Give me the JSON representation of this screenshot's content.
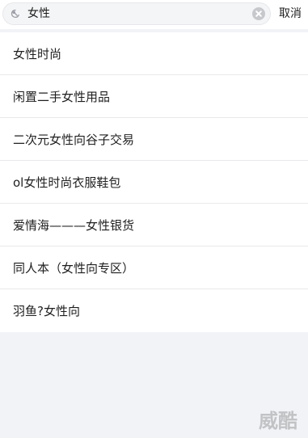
{
  "search": {
    "value": "女性",
    "cancel_label": "取消"
  },
  "suggestions": [
    "女性时尚",
    "闲置二手女性用品",
    "二次元女性向谷子交易",
    "ol女性时尚衣服鞋包",
    "爱情海———女性银货",
    "同人本（女性向专区）",
    "羽鱼?女性向"
  ],
  "watermark": {
    "text": "威酷"
  },
  "icons": {
    "search": "search-icon",
    "clear": "clear-icon"
  },
  "colors": {
    "background": "#f2f3f7",
    "list_background": "#ffffff",
    "divider": "#e9e9ec",
    "clear_icon": "#c7c8cc"
  }
}
